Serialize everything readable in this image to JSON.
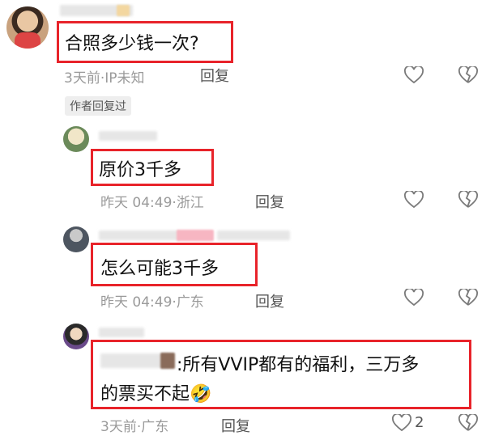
{
  "colors": {
    "highlight_border": "#e8232a",
    "meta_text": "#9a9a9a",
    "icon_stroke": "#7a7a7a"
  },
  "comments": [
    {
      "text": "合照多少钱一次?",
      "time": "3天前",
      "location": "IP未知",
      "reply_label": "回复",
      "author_tag": "作者回复过"
    },
    {
      "text": "原价3千多",
      "time": "昨天 04:49",
      "location": "浙江",
      "reply_label": "回复"
    },
    {
      "text": "怎么可能3千多",
      "time": "昨天 04:49",
      "location": "广东",
      "reply_label": "回复"
    },
    {
      "mention_separator": ":",
      "text_line1": "所有VVIP都有的福利，三万多",
      "text_line2": "的票买不起",
      "emoji": "🤣",
      "time": "3天前",
      "location": "广东",
      "reply_label": "回复",
      "like_count": "2"
    }
  ],
  "icons": {
    "like": "heart-outline-icon",
    "dislike": "broken-heart-icon"
  }
}
